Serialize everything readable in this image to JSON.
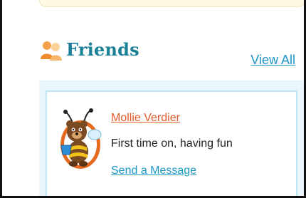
{
  "friends": {
    "title": "Friends",
    "view_all_label": "View All",
    "icon": "friends-icon",
    "items": [
      {
        "name": "Mollie Verdier",
        "status": "First time on, having fun",
        "action_label": "Send a Message",
        "avatar": "bee-bear-avatar"
      }
    ]
  },
  "colors": {
    "title": "#1a8098",
    "link": "#1b96c5",
    "name_link": "#e05a2b",
    "panel_bg": "#e9f6fb",
    "card_border": "#bde5f2"
  }
}
